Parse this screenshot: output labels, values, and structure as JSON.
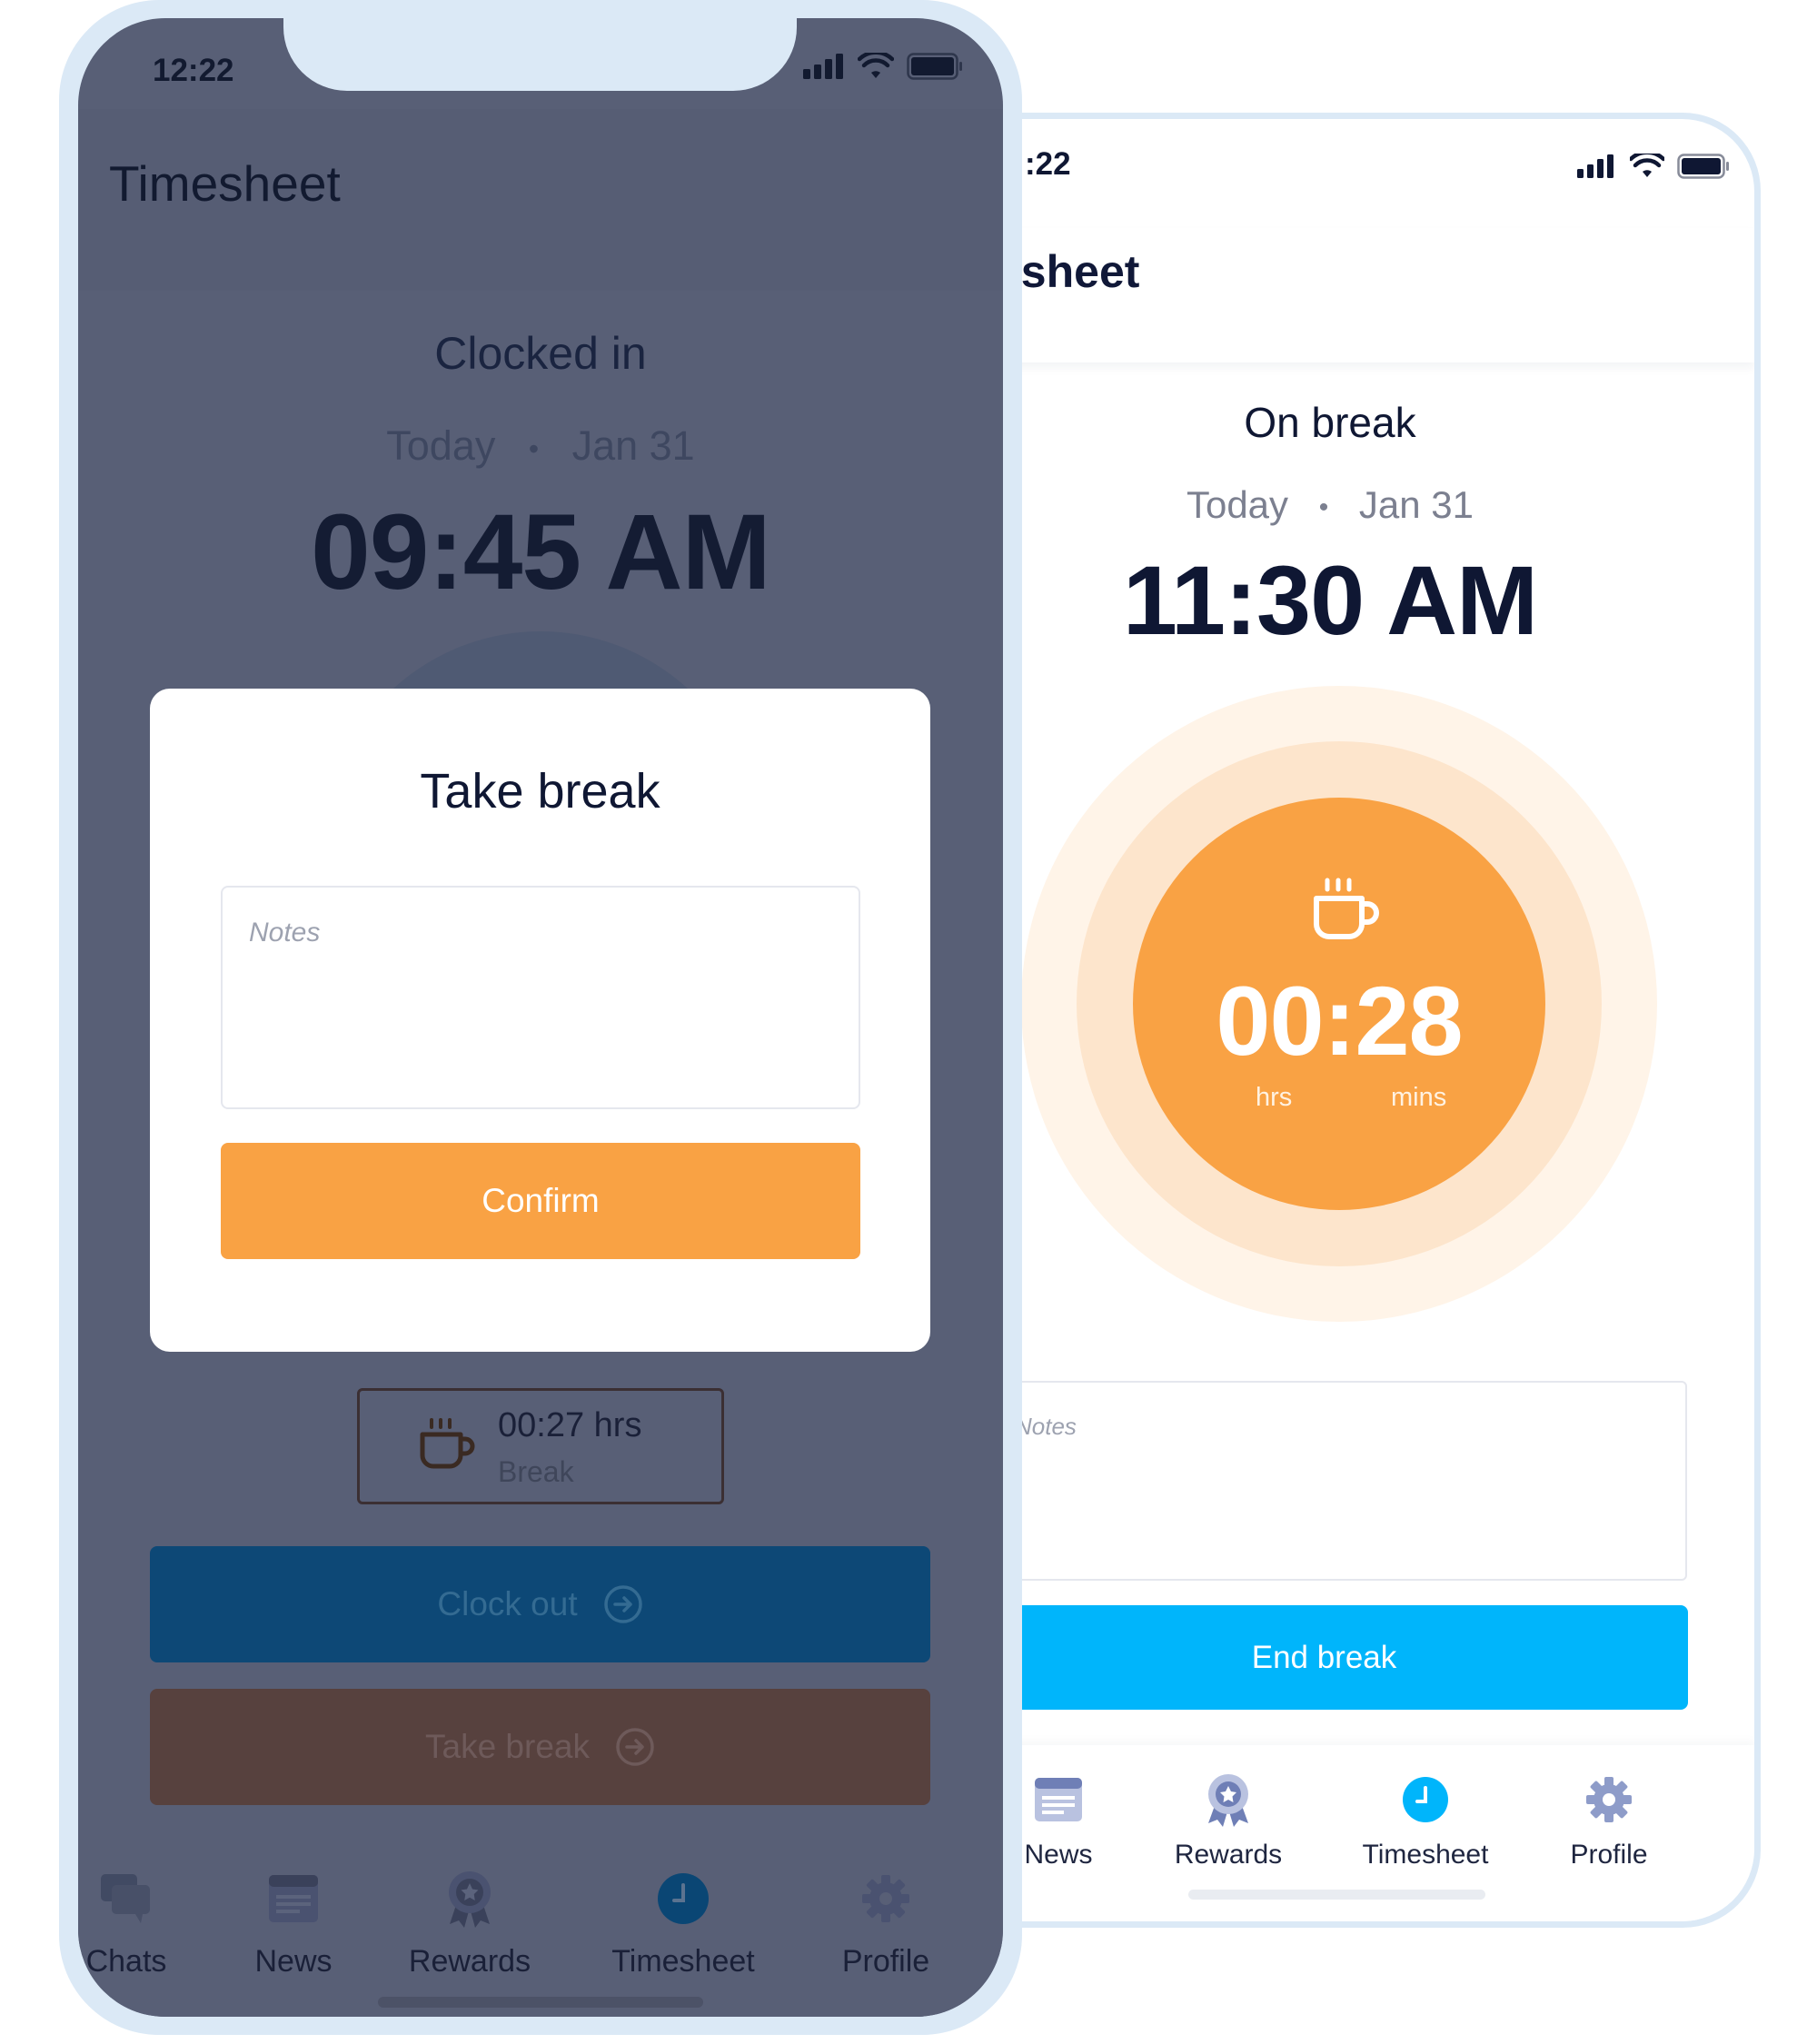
{
  "right_phone": {
    "status_time": ":22",
    "title": "esheet",
    "state": "On break",
    "date_day": "Today",
    "date_sep": "•",
    "date": "Jan 31",
    "clock": "11:30 AM",
    "timer": "00:28",
    "timer_hrs_label": "hrs",
    "timer_mins_label": "mins",
    "notes_placeholder": "Notes",
    "end_break_label": "End break",
    "nav": [
      {
        "label": "News",
        "icon": "news-icon"
      },
      {
        "label": "Rewards",
        "icon": "rewards-icon"
      },
      {
        "label": "Timesheet",
        "icon": "clock-icon",
        "active": true
      },
      {
        "label": "Profile",
        "icon": "gear-icon"
      }
    ],
    "colors": {
      "accent_orange": "#f9a244",
      "accent_blue": "#00b5fb"
    }
  },
  "left_phone": {
    "status_time": "12:22",
    "title": "Timesheet",
    "state": "Clocked in",
    "date_day": "Today",
    "date_sep": "•",
    "date": "Jan 31",
    "clock": "09:45 AM",
    "modal": {
      "title": "Take break",
      "notes_placeholder": "Notes",
      "confirm_label": "Confirm"
    },
    "break_summary": {
      "value": "00:27 hrs",
      "label": "Break"
    },
    "clock_out_label": "Clock out",
    "take_break_label": "Take break",
    "nav": [
      {
        "label": "Chats",
        "icon": "chat-icon"
      },
      {
        "label": "News",
        "icon": "news-icon"
      },
      {
        "label": "Rewards",
        "icon": "rewards-icon"
      },
      {
        "label": "Timesheet",
        "icon": "clock-icon",
        "active": true
      },
      {
        "label": "Profile",
        "icon": "gear-icon"
      }
    ],
    "colors": {
      "overlay": "#585f76",
      "clock_out": "#0d4876",
      "take_break": "#57413e"
    }
  }
}
